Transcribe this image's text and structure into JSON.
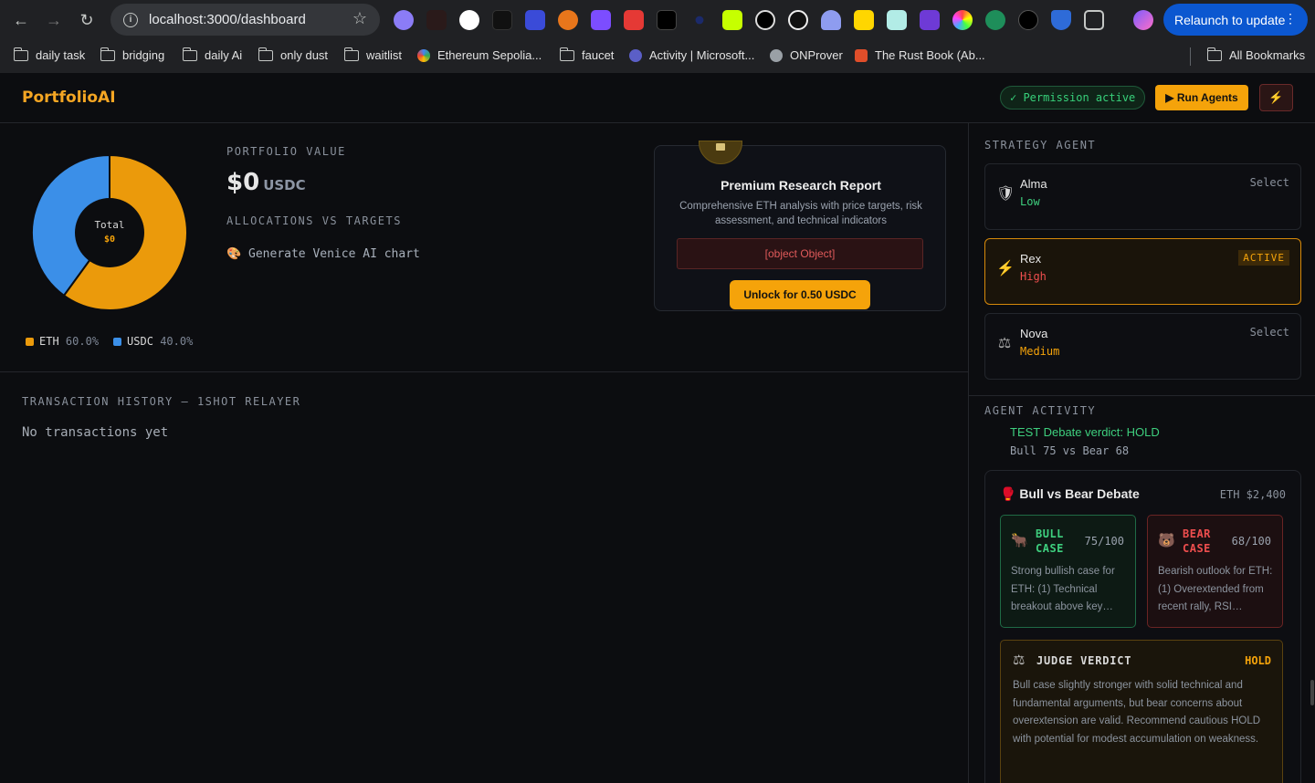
{
  "browser": {
    "url": "localhost:3000/dashboard",
    "relaunch_label": "Relaunch to update",
    "bookmarks": [
      {
        "label": "daily task",
        "kind": "folder"
      },
      {
        "label": "bridging",
        "kind": "folder"
      },
      {
        "label": "daily Ai",
        "kind": "folder"
      },
      {
        "label": "only dust",
        "kind": "folder"
      },
      {
        "label": "waitlist",
        "kind": "folder"
      },
      {
        "label": "Ethereum Sepolia...",
        "kind": "site"
      },
      {
        "label": "faucet",
        "kind": "folder"
      },
      {
        "label": "Activity | Microsoft...",
        "kind": "site"
      },
      {
        "label": "ONProver",
        "kind": "site"
      },
      {
        "label": "The Rust Book (Ab...",
        "kind": "site"
      }
    ],
    "all_bookmarks": "All Bookmarks"
  },
  "header": {
    "logo": "PortfolioAI",
    "permission": "✓ Permission active",
    "run_agents": "▶ Run Agents",
    "plug_icon": "plug-icon"
  },
  "portfolio": {
    "value_label": "PORTFOLIO VALUE",
    "value": "$0",
    "unit": "USDC",
    "alloc_label": "ALLOCATIONS VS TARGETS",
    "venice": "🎨 Generate Venice AI chart",
    "donut_center_label": "Total",
    "donut_center_value": "$0"
  },
  "chart_data": {
    "type": "pie",
    "categories": [
      "ETH",
      "USDC"
    ],
    "values": [
      60.0,
      40.0
    ],
    "colors": [
      "#eb9a0b",
      "#3b8fe8"
    ],
    "legend": [
      {
        "name": "ETH",
        "pct": "60.0%"
      },
      {
        "name": "USDC",
        "pct": "40.0%"
      }
    ]
  },
  "research": {
    "title": "Premium Research Report",
    "description": "Comprehensive ETH analysis with price targets, risk assessment, and technical indicators",
    "error": "[object Object]",
    "unlock": "Unlock for 0.50 USDC"
  },
  "transactions": {
    "label": "TRANSACTION HISTORY — 1SHOT RELAYER",
    "empty": "No transactions yet"
  },
  "strategy": {
    "label": "STRATEGY AGENT",
    "agents": [
      {
        "name": "Alma",
        "risk": "Low",
        "risk_color": "#3ecf7e",
        "action": "Select",
        "icon": "shield-icon"
      },
      {
        "name": "Rex",
        "risk": "High",
        "risk_color": "#ef4e4e",
        "action": "ACTIVE",
        "icon": "lightning-icon"
      },
      {
        "name": "Nova",
        "risk": "Medium",
        "risk_color": "#f5a30a",
        "action": "Select",
        "icon": "scales-icon"
      }
    ]
  },
  "activity": {
    "label": "AGENT ACTIVITY",
    "verdict_line": "TEST Debate verdict: HOLD",
    "verdict_sub": "Bull 75 vs Bear 68",
    "debate": {
      "title": "🥊 Bull vs Bear Debate",
      "price": "ETH $2,400",
      "bull": {
        "label_1": "BULL",
        "label_2": "CASE",
        "score": "75/100",
        "text": "Strong bullish case for ETH: (1) Technical breakout above key…",
        "emoji": "🐂"
      },
      "bear": {
        "label_1": "BEAR",
        "label_2": "CASE",
        "score": "68/100",
        "text": "Bearish outlook for ETH: (1) Overextended from recent rally, RSI…",
        "emoji": "🐻"
      },
      "judge": {
        "label": "JUDGE VERDICT",
        "verdict": "HOLD",
        "text": "Bull case slightly stronger with solid technical and fundamental arguments, but bear concerns about overextension are valid. Recommend cautious HOLD with potential for modest accumulation on weakness."
      }
    }
  }
}
